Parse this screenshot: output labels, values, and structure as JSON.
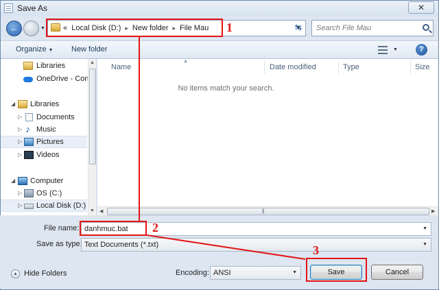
{
  "window": {
    "title": "Save As",
    "close": "✕"
  },
  "nav": {
    "back": "←",
    "breadcrumb": [
      "«",
      "Local Disk (D:)",
      "New folder",
      "File Mau"
    ],
    "separators": [
      "▸",
      "▸"
    ],
    "search_placeholder": "Search File Mau",
    "refresh": "⇆"
  },
  "toolbar": {
    "organize": "Organize",
    "new_folder": "New folder",
    "help": "?"
  },
  "sidebar": {
    "items": [
      {
        "label": "Libraries"
      },
      {
        "label": "OneDrive - Conc"
      },
      {
        "label": "Libraries"
      },
      {
        "label": "Documents"
      },
      {
        "label": "Music"
      },
      {
        "label": "Pictures"
      },
      {
        "label": "Videos"
      },
      {
        "label": "Computer"
      },
      {
        "label": "OS (C:)"
      },
      {
        "label": "Local Disk (D:)"
      }
    ]
  },
  "filelist": {
    "columns": [
      "Name",
      "Date modified",
      "Type",
      "Size"
    ],
    "empty_message": "No items match your search."
  },
  "form": {
    "file_name_label": "File name:",
    "file_name_value": "danhmuc.bat",
    "save_as_type_label": "Save as type:",
    "save_as_type_value": "Text Documents (*.txt)",
    "encoding_label": "Encoding:",
    "encoding_value": "ANSI"
  },
  "footer": {
    "hide_folders": "Hide Folders",
    "save": "Save",
    "cancel": "Cancel"
  },
  "annotations": {
    "n1": "1",
    "n2": "2",
    "n3": "3",
    "color": "#e31414"
  }
}
